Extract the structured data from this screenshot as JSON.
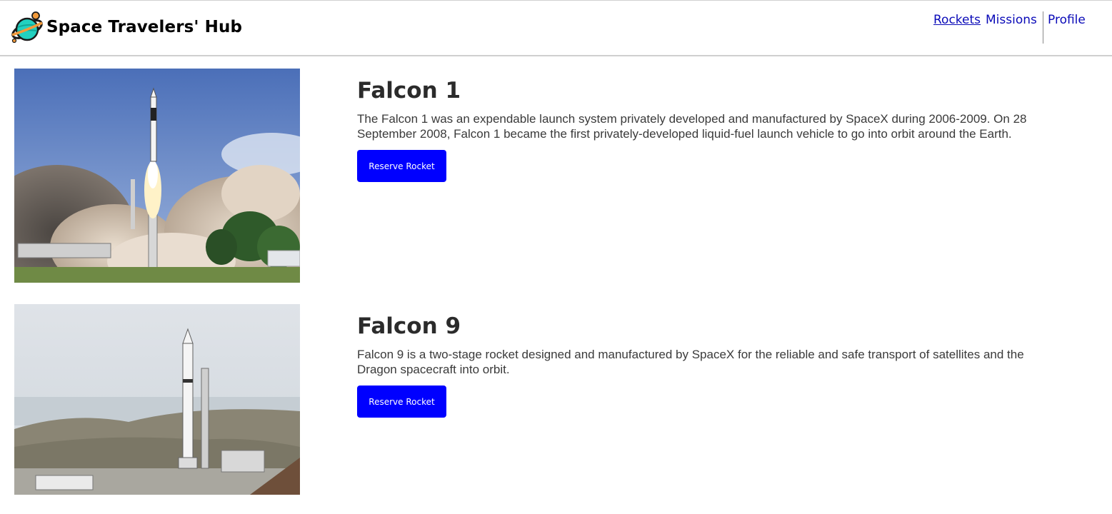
{
  "header": {
    "brand": "Space Travelers' Hub",
    "logo_icon": "planet-icon",
    "nav": {
      "rockets": "Rockets",
      "missions": "Missions",
      "profile": "Profile"
    },
    "active_nav": "rockets"
  },
  "rockets": [
    {
      "name": "Falcon 1",
      "description": "The Falcon 1 was an expendable launch system privately developed and manufactured by SpaceX during 2006-2009. On 28 September 2008, Falcon 1 became the first privately-developed liquid-fuel launch vehicle to go into orbit around the Earth.",
      "button_label": "Reserve Rocket"
    },
    {
      "name": "Falcon 9",
      "description": "Falcon 9 is a two-stage rocket designed and manufactured by SpaceX for the reliable and safe transport of satellites and the Dragon spacecraft into orbit.",
      "button_label": "Reserve Rocket"
    }
  ],
  "colors": {
    "accent": "#0000ff",
    "nav_link": "#0a0ab8",
    "title": "#2b2b2b"
  }
}
